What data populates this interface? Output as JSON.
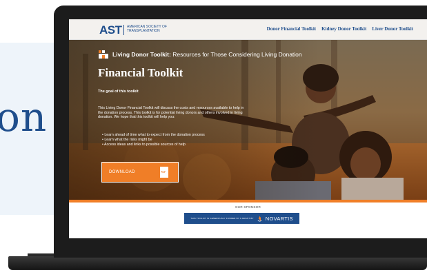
{
  "background": {
    "headline_fragment": "on"
  },
  "site": {
    "logo_text": "AST",
    "logo_subtitle": "AMERICAN SOCIETY OF TRANSPLANTATION",
    "nav": [
      "Donor Financial Toolkit",
      "Kidney Donor Toolkit",
      "Liver Donor Toolkit"
    ]
  },
  "hero": {
    "brand_bold": "Living Donor Toolkit:",
    "brand_rest": " Resources for Those Considering Living Donation",
    "title": "Financial Toolkit",
    "goal_heading": "The goal of this toolkit",
    "intro": "This Living Donor Financial Toolkit will discuss the costs and resources available to help in the donation process. This toolkit is for potential living donors and others involved in living donation. We hope that this toolkit will help you:",
    "bullets": [
      "Learn ahead of time what to expect from the donation process",
      "Learn what the risks might be",
      "Access ideas and links to possible sources of help"
    ],
    "download_label": "DOWNLOAD",
    "pdf_label": "PDF"
  },
  "sponsor": {
    "label": "OUR SPONSOR",
    "banner_text": "THIS TOOLKIT IS GENEROUSLY FUNDED BY A GRANT BY",
    "brand": "NOVARTIS"
  },
  "colors": {
    "brand_blue": "#1f4e8c",
    "accent_orange": "#f07e27"
  }
}
